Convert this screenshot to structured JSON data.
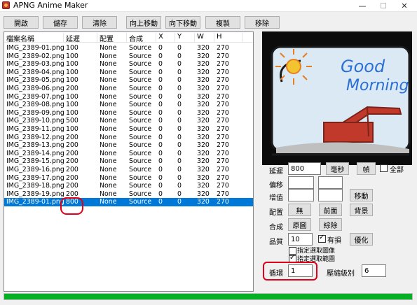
{
  "window": {
    "title": "APNG Anime Maker"
  },
  "toolbar": {
    "open": "開啟",
    "save": "儲存",
    "clear": "清除",
    "move_up": "向上移動",
    "move_down": "向下移動",
    "copy": "複製",
    "remove": "移除"
  },
  "list": {
    "columns": [
      "檔案名稱",
      "延遲",
      "配置",
      "合成",
      "X",
      "Y",
      "W",
      "H"
    ],
    "rows": [
      [
        "IMG_2389-01.png",
        "100",
        "None",
        "Source",
        "0",
        "0",
        "320",
        "270"
      ],
      [
        "IMG_2389-02.png",
        "100",
        "None",
        "Source",
        "0",
        "0",
        "320",
        "270"
      ],
      [
        "IMG_2389-03.png",
        "100",
        "None",
        "Source",
        "0",
        "0",
        "320",
        "270"
      ],
      [
        "IMG_2389-04.png",
        "100",
        "None",
        "Source",
        "0",
        "0",
        "320",
        "270"
      ],
      [
        "IMG_2389-05.png",
        "100",
        "None",
        "Source",
        "0",
        "0",
        "320",
        "270"
      ],
      [
        "IMG_2389-06.png",
        "200",
        "None",
        "Source",
        "0",
        "0",
        "320",
        "270"
      ],
      [
        "IMG_2389-07.png",
        "100",
        "None",
        "Source",
        "0",
        "0",
        "320",
        "270"
      ],
      [
        "IMG_2389-08.png",
        "100",
        "None",
        "Source",
        "0",
        "0",
        "320",
        "270"
      ],
      [
        "IMG_2389-09.png",
        "100",
        "None",
        "Source",
        "0",
        "0",
        "320",
        "270"
      ],
      [
        "IMG_2389-10.png",
        "500",
        "None",
        "Source",
        "0",
        "0",
        "320",
        "270"
      ],
      [
        "IMG_2389-11.png",
        "100",
        "None",
        "Source",
        "0",
        "0",
        "320",
        "270"
      ],
      [
        "IMG_2389-12.png",
        "200",
        "None",
        "Source",
        "0",
        "0",
        "320",
        "270"
      ],
      [
        "IMG_2389-13.png",
        "200",
        "None",
        "Source",
        "0",
        "0",
        "320",
        "270"
      ],
      [
        "IMG_2389-14.png",
        "200",
        "None",
        "Source",
        "0",
        "0",
        "320",
        "270"
      ],
      [
        "IMG_2389-15.png",
        "200",
        "None",
        "Source",
        "0",
        "0",
        "320",
        "270"
      ],
      [
        "IMG_2389-16.png",
        "200",
        "None",
        "Source",
        "0",
        "0",
        "320",
        "270"
      ],
      [
        "IMG_2389-17.png",
        "200",
        "None",
        "Source",
        "0",
        "0",
        "320",
        "270"
      ],
      [
        "IMG_2389-18.png",
        "200",
        "None",
        "Source",
        "0",
        "0",
        "320",
        "270"
      ],
      [
        "IMG_2389-19.png",
        "200",
        "None",
        "Source",
        "0",
        "0",
        "320",
        "270"
      ],
      [
        "IMG_2389-01.png",
        "800",
        "None",
        "Source",
        "0",
        "0",
        "320",
        "270"
      ]
    ],
    "selected_index": 19
  },
  "preview": {
    "text_line1": "Good",
    "text_line2": "Morning"
  },
  "props": {
    "delay_label": "延遲",
    "delay_value": "800",
    "ms_button": "毫秒",
    "frame_button": "幀",
    "all_label": "全部",
    "offset_label": "偏移",
    "offset_x": "",
    "offset_y": "",
    "increment_label": "增值",
    "increment_x": "",
    "increment_y": "",
    "move_button": "移動",
    "dispose_label": "配置",
    "dispose_none": "無",
    "dispose_previous": "前面",
    "dispose_background": "背景",
    "blend_label": "合成",
    "blend_source": "原圖",
    "blend_over": "綜除",
    "quality_label": "品質",
    "quality_value": "10",
    "lossy_label": "有損",
    "optimize_button": "優化",
    "specify_image_label": "指定選取圖像",
    "specify_range_label": "指定選取範圍",
    "loop_label": "循環",
    "loop_value": "1",
    "compression_label": "壓縮級別",
    "compression_value": "6"
  },
  "status": {
    "progress": 1.0
  },
  "colors": {
    "progress": "#06b025",
    "selection": "#0078d7",
    "annotation": "#e0001a"
  }
}
